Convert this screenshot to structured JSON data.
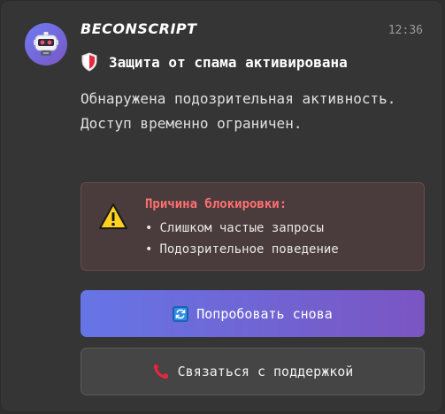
{
  "header": {
    "app_name": "BECONSCRIPT",
    "time": "12:36",
    "avatar_icon": "robot-icon"
  },
  "notification": {
    "title_icon": "shield-icon",
    "title": "Защита от спама активирована",
    "message": "Обнаружена подозрительная активность. Доступ временно ограничен."
  },
  "reason": {
    "icon": "warning-icon",
    "title": "Причина блокировки:",
    "items": [
      "Слишком частые запросы",
      "Подозрительное поведение"
    ]
  },
  "actions": {
    "retry_label": "Попробовать снова",
    "retry_icon": "refresh-icon",
    "support_label": "Связаться с поддержкой",
    "support_icon": "phone-icon"
  },
  "colors": {
    "card_bg": "#353536",
    "accent_start": "#6675e6",
    "accent_end": "#7a55c2",
    "danger_text": "#ff7070",
    "reason_bg": "#4a3b3c"
  }
}
